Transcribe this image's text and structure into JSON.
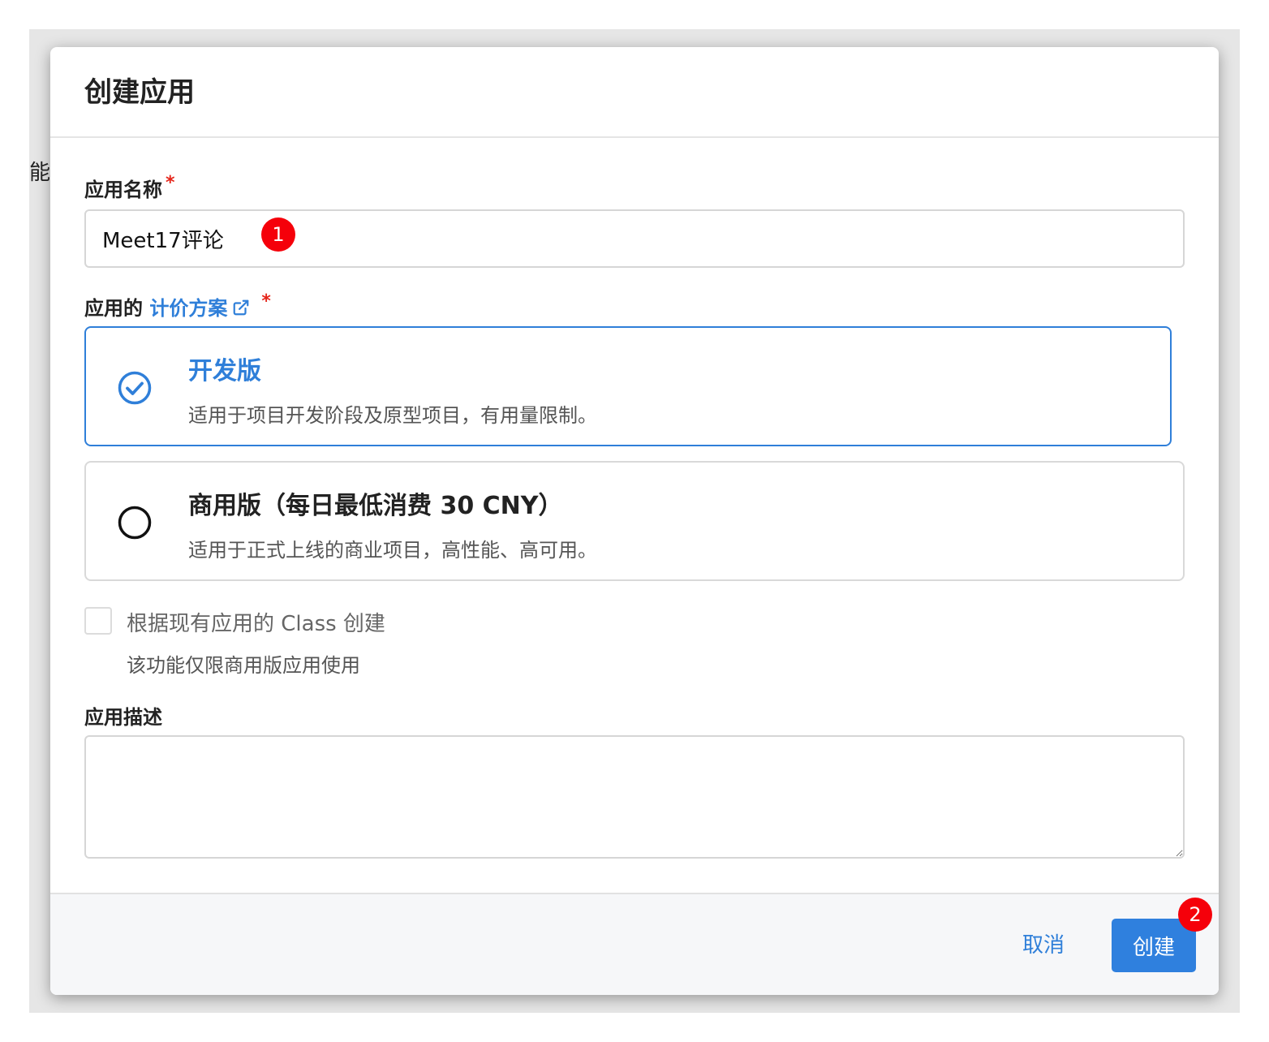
{
  "background": {
    "partial_text": "能够"
  },
  "dialog": {
    "title": "创建应用",
    "name_field": {
      "label": "应用名称",
      "required_mark": "*",
      "value": "Meet17评论",
      "badge": "1"
    },
    "plan_field": {
      "label_prefix": "应用的 ",
      "label_link": "计价方案",
      "required_mark": "*",
      "link_icon": "external-link-icon"
    },
    "plans": [
      {
        "name": "开发版",
        "description": "适用于项目开发阶段及原型项目，有用量限制。",
        "selected": true
      },
      {
        "name": "商用版（每日最低消费 30 CNY）",
        "description": "适用于正式上线的商业项目，高性能、高可用。",
        "selected": false
      }
    ],
    "class_option": {
      "label": "根据现有应用的 Class 创建",
      "hint": "该功能仅限商用版应用使用",
      "checked": false
    },
    "description_field": {
      "label": "应用描述",
      "value": ""
    },
    "footer": {
      "cancel_label": "取消",
      "create_label": "创建",
      "create_badge": "2"
    }
  },
  "colors": {
    "accent": "#2f7fd9",
    "button": "#2f80de",
    "required": "#e5261b",
    "badge": "#f5000a"
  }
}
